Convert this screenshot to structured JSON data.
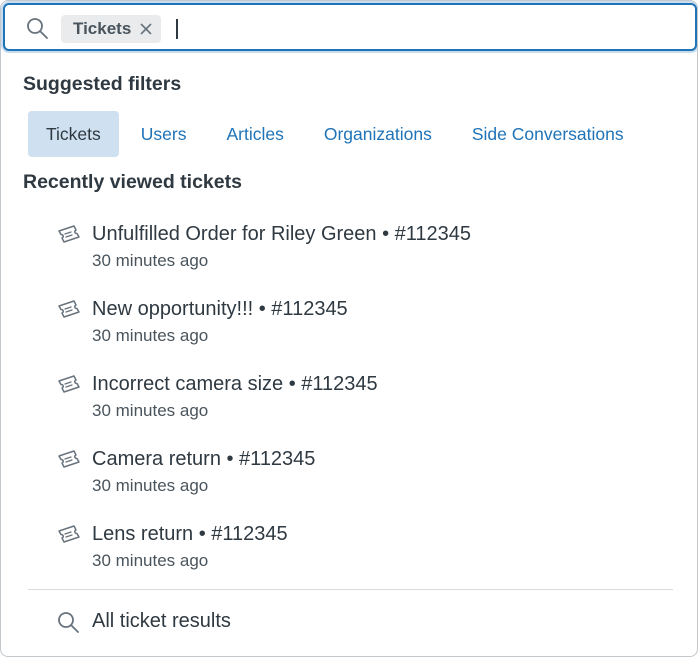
{
  "search": {
    "token_label": "Tickets",
    "input_value": ""
  },
  "suggested": {
    "title": "Suggested filters",
    "filters": [
      "Tickets",
      "Users",
      "Articles",
      "Organizations",
      "Side Conversations"
    ]
  },
  "recent": {
    "title": "Recently viewed tickets",
    "items": [
      {
        "title": "Unfulfilled Order for Riley Green • #112345",
        "time": "30 minutes ago"
      },
      {
        "title": "New opportunity!!! • #112345",
        "time": "30 minutes ago"
      },
      {
        "title": "Incorrect camera size • #112345",
        "time": "30 minutes ago"
      },
      {
        "title": "Camera return • #112345",
        "time": "30 minutes ago"
      },
      {
        "title": "Lens return • #112345",
        "time": "30 minutes ago"
      }
    ]
  },
  "footer": {
    "all_results_label": "All ticket results"
  },
  "colors": {
    "accent": "#1f73b7",
    "active_filter_bg": "#cfe0f0",
    "text": "#2f3941"
  },
  "icons": {
    "search": "search-icon",
    "ticket": "ticket-icon",
    "close": "close-icon"
  }
}
